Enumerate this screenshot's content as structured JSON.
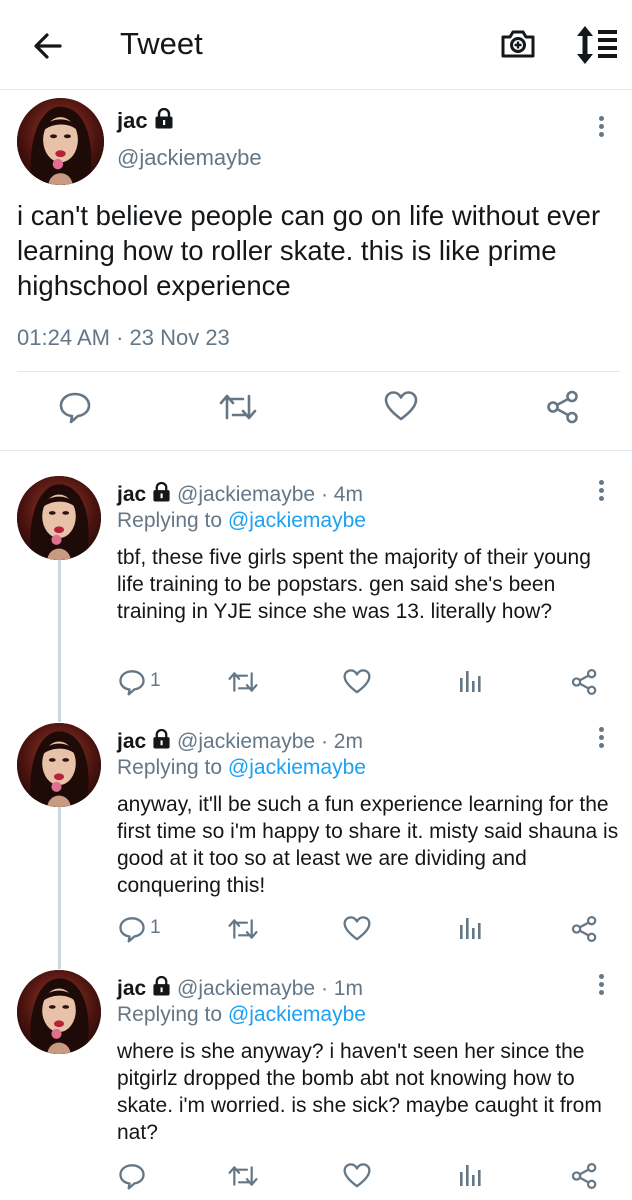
{
  "header": {
    "title": "Tweet"
  },
  "main_tweet": {
    "name": "jac",
    "handle": "@jackiemaybe",
    "text": "i can't believe people can go on life without ever learning how to roller skate. this is like prime highschool experience",
    "timestamp": "01:24 AM · 23 Nov 23"
  },
  "replies": [
    {
      "name": "jac",
      "handle": "@jackiemaybe",
      "time": "· 4m",
      "replying_prefix": "Replying to ",
      "replying_to": "@jackiemaybe",
      "text": "tbf, these five girls spent the majority of their young life training to be popstars. gen said she's been training in YJE since she was 13. literally how?",
      "reply_count": "1"
    },
    {
      "name": "jac",
      "handle": "@jackiemaybe",
      "time": "· 2m",
      "replying_prefix": "Replying to ",
      "replying_to": "@jackiemaybe",
      "text": "anyway, it'll be such a fun experience learning for the first time so i'm happy to share it. misty said shauna is good at it too so at least we are dividing and conquering this!",
      "reply_count": "1"
    },
    {
      "name": "jac",
      "handle": "@jackiemaybe",
      "time": "· 1m",
      "replying_prefix": "Replying to ",
      "replying_to": "@jackiemaybe",
      "text": "where is she anyway? i haven't seen her since the pitgirlz dropped the bomb abt not knowing how to skate. i'm worried. is she sick? maybe caught it from nat?",
      "reply_count": ""
    }
  ],
  "icons": {
    "back": "arrow-left-icon",
    "camera": "camera-plus-icon",
    "sort": "sort-icon",
    "lock": "lock-icon",
    "reply": "reply-icon",
    "retweet": "retweet-icon",
    "like": "heart-icon",
    "analytics": "analytics-icon",
    "share": "share-icon",
    "more": "more-vertical-icon"
  },
  "colors": {
    "link": "#1da1f2",
    "secondary_text": "#657786",
    "icon": "#657786"
  }
}
